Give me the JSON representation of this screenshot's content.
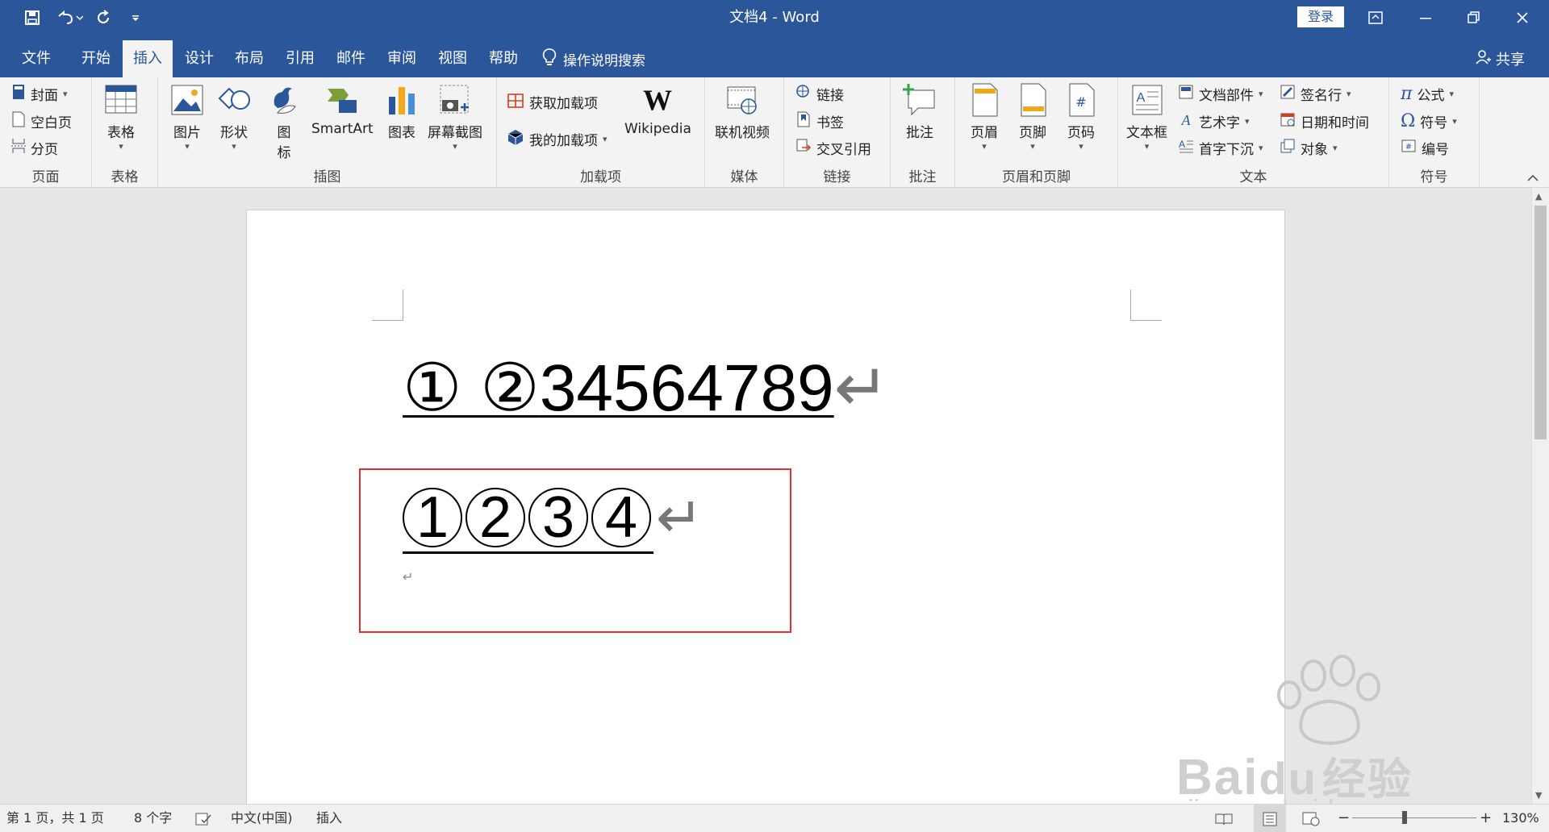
{
  "title_bar": {
    "title": "文档4  -  Word",
    "login_label": "登录"
  },
  "tabs": [
    {
      "label": "文件"
    },
    {
      "label": "开始"
    },
    {
      "label": "插入",
      "active": true
    },
    {
      "label": "设计"
    },
    {
      "label": "布局"
    },
    {
      "label": "引用"
    },
    {
      "label": "邮件"
    },
    {
      "label": "审阅"
    },
    {
      "label": "视图"
    },
    {
      "label": "帮助"
    }
  ],
  "tell_me": "操作说明搜索",
  "share": "共享",
  "ribbon": {
    "pages": {
      "label": "页面",
      "cover": "封面",
      "blank": "空白页",
      "break": "分页"
    },
    "tables": {
      "label": "表格",
      "table": "表格"
    },
    "illustrations": {
      "label": "插图",
      "picture": "图片",
      "shapes": "形状",
      "icons_line1": "图",
      "icons_line2": "标",
      "smartart": "SmartArt",
      "chart": "图表",
      "screenshot": "屏幕截图"
    },
    "addins": {
      "label": "加载项",
      "get": "获取加载项",
      "my": "我的加载项",
      "wikipedia": "Wikipedia"
    },
    "media": {
      "label": "媒体",
      "video": "联机视频"
    },
    "links": {
      "label": "链接",
      "link": "链接",
      "bookmark": "书签",
      "xref": "交叉引用"
    },
    "comments": {
      "label": "批注",
      "comment": "批注"
    },
    "header_footer": {
      "label": "页眉和页脚",
      "header": "页眉",
      "footer": "页脚",
      "page_number": "页码"
    },
    "text": {
      "label": "文本",
      "textbox": "文本框",
      "quickparts": "文档部件",
      "wordart": "艺术字",
      "dropcap": "首字下沉",
      "signature": "签名行",
      "datetime": "日期和时间",
      "object": "对象"
    },
    "symbols": {
      "label": "符号",
      "equation": "公式",
      "symbol": "符号",
      "number": "编号"
    }
  },
  "document": {
    "line1_circled": "① ②",
    "line1_digits": "34564789",
    "paragraph_mark": "↵",
    "line2": [
      "1",
      "2",
      "3",
      "4"
    ]
  },
  "watermark": {
    "brand": "Bai",
    "brand2": "du",
    "cn": "经验",
    "url": "jingyan.baidu.com"
  },
  "status_bar": {
    "page": "第 1 页，共 1 页",
    "words": "8 个字",
    "language": "中文(中国)",
    "mode": "插入",
    "zoom": "130%",
    "zoom_fraction": 0.42
  },
  "colors": {
    "brand": "#2b579a",
    "highlight_box": "#e0302f"
  }
}
